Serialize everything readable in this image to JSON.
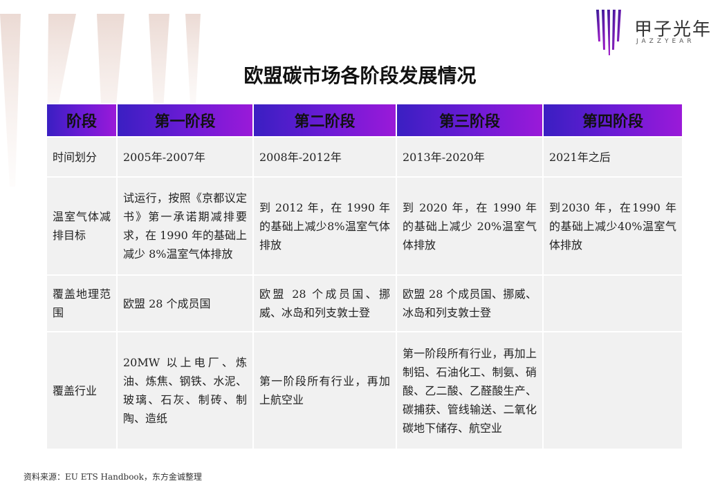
{
  "brand": {
    "name": "甲子光年",
    "subname": "JAZZYEAR"
  },
  "title": "欧盟碳市场各阶段发展情况",
  "table": {
    "headers": [
      "阶段",
      "第一阶段",
      "第二阶段",
      "第三阶段",
      "第四阶段"
    ],
    "rows": [
      {
        "label": "时间划分",
        "cells": [
          "2005年-2007年",
          "2008年-2012年",
          "2013年-2020年",
          "2021年之后"
        ]
      },
      {
        "label": "温室气体减排目标",
        "cells": [
          "试运行，按照《京都议定书》第一承诺期减排要求，在 1990 年的基础上减少 8%温室气体排放",
          "到 2012 年，在 1990 年的基础上减少8%温室气体排放",
          "到 2020 年，在 1990 年的基础上减少 20%温室气体排放",
          "到2030 年，在1990 年的基础上减少40%温室气体排放"
        ]
      },
      {
        "label": "覆盖地理范围",
        "cells": [
          "欧盟 28 个成员国",
          "欧盟 28 个成员国、挪威、冰岛和列支敦士登",
          "欧盟 28 个成员国、挪威、冰岛和列支敦士登",
          ""
        ]
      },
      {
        "label": "覆盖行业",
        "cells": [
          "20MW 以上电厂、炼油、炼焦、钢铁、水泥、玻璃、石灰、制砖、制陶、造纸",
          "第一阶段所有行业，再加上航空业",
          "第一阶段所有行业，再加上制铝、石油化工、制氨、硝酸、乙二酸、乙醛酸生产、碳捕获、管线输送、二氧化碳地下储存、航空业",
          ""
        ]
      }
    ]
  },
  "source": "资料来源：EU ETS Handbook，东方金诚整理",
  "colors": {
    "header_start": "#3a1fc2",
    "header_end": "#9a1ad8",
    "cell_bg": "#f1f1f1"
  }
}
